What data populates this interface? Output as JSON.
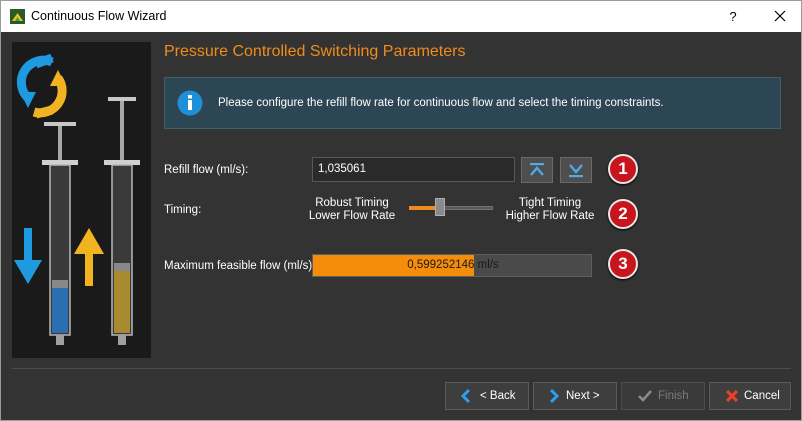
{
  "window": {
    "title": "Continuous Flow Wizard",
    "help_label": "?"
  },
  "page": {
    "title": "Pressure Controlled Switching Parameters",
    "info_message": "Please configure the refill flow rate for continuous flow and select the timing constraints."
  },
  "refill": {
    "label": "Refill flow (ml/s):",
    "value": "1,035061",
    "badge": "1"
  },
  "timing": {
    "label": "Timing:",
    "left_line1": "Robust Timing",
    "left_line2": "Lower Flow Rate",
    "right_line1": "Tight Timing",
    "right_line2": "Higher Flow Rate",
    "slider_level": 0.35,
    "badge": "2"
  },
  "max_flow": {
    "label": "Maximum feasible flow (ml/s):",
    "value_text": "0,599252146 ml/s",
    "fill_fraction": 0.58,
    "badge": "3"
  },
  "buttons": {
    "back": "< Back",
    "next": "Next >",
    "finish": "Finish",
    "cancel": "Cancel"
  },
  "colors": {
    "accent": "#f08c1c",
    "badge": "#c8141c",
    "info_icon": "#1e90d8"
  }
}
